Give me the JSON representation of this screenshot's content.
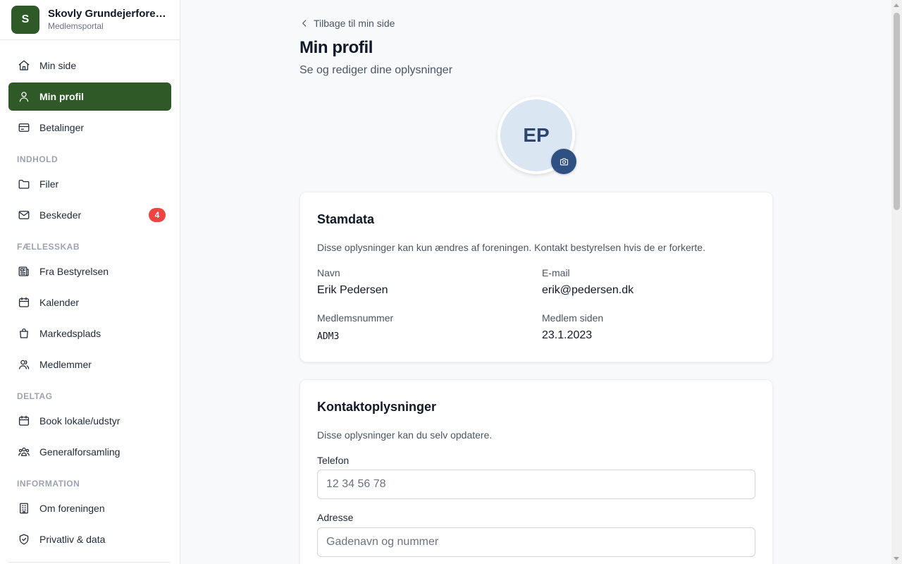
{
  "brand": {
    "logo_letter": "S",
    "name": "Skovly Grundejerforening",
    "subtitle": "Medlemsportal",
    "color": "#2f5a27"
  },
  "nav": {
    "main": [
      {
        "label": "Min side",
        "icon": "home-icon"
      },
      {
        "label": "Min profil",
        "icon": "user-icon",
        "active": true
      },
      {
        "label": "Betalinger",
        "icon": "credit-card-icon"
      }
    ],
    "sections": [
      {
        "title": "INDHOLD",
        "items": [
          {
            "label": "Filer",
            "icon": "folder-icon"
          },
          {
            "label": "Beskeder",
            "icon": "mail-icon",
            "badge": "4"
          }
        ]
      },
      {
        "title": "FÆLLESSKAB",
        "items": [
          {
            "label": "Fra Bestyrelsen",
            "icon": "newspaper-icon"
          },
          {
            "label": "Kalender",
            "icon": "calendar-icon"
          },
          {
            "label": "Markedsplads",
            "icon": "shopping-bag-icon"
          },
          {
            "label": "Medlemmer",
            "icon": "users-icon"
          }
        ]
      },
      {
        "title": "DELTAG",
        "items": [
          {
            "label": "Book lokale/udstyr",
            "icon": "calendar-icon"
          },
          {
            "label": "Generalforsamling",
            "icon": "group-icon"
          }
        ]
      },
      {
        "title": "INFORMATION",
        "items": [
          {
            "label": "Om foreningen",
            "icon": "building-icon"
          },
          {
            "label": "Privatliv & data",
            "icon": "shield-icon"
          }
        ]
      }
    ]
  },
  "page": {
    "back_link": "Tilbage til min side",
    "title": "Min profil",
    "subtitle": "Se og rediger dine oplysninger"
  },
  "avatar": {
    "initials": "EP",
    "bg": "#dbe6f3",
    "camera_bg": "#2e5082"
  },
  "stamdata": {
    "title": "Stamdata",
    "description": "Disse oplysninger kan kun ændres af foreningen. Kontakt bestyrelsen hvis de er forkerte.",
    "name_label": "Navn",
    "name_value": "Erik Pedersen",
    "email_label": "E-mail",
    "email_value": "erik@pedersen.dk",
    "member_no_label": "Medlemsnummer",
    "member_no_value": "ADM3",
    "member_since_label": "Medlem siden",
    "member_since_value": "23.1.2023"
  },
  "kontakt": {
    "title": "Kontaktoplysninger",
    "description": "Disse oplysninger kan du selv opdatere.",
    "phone_label": "Telefon",
    "phone_value": "",
    "phone_placeholder": "12 34 56 78",
    "address_label": "Adresse",
    "address_value": "",
    "address_placeholder": "Gadenavn og nummer"
  },
  "colors": {
    "badge": "#ef4444",
    "primary": "#2f5a27"
  }
}
